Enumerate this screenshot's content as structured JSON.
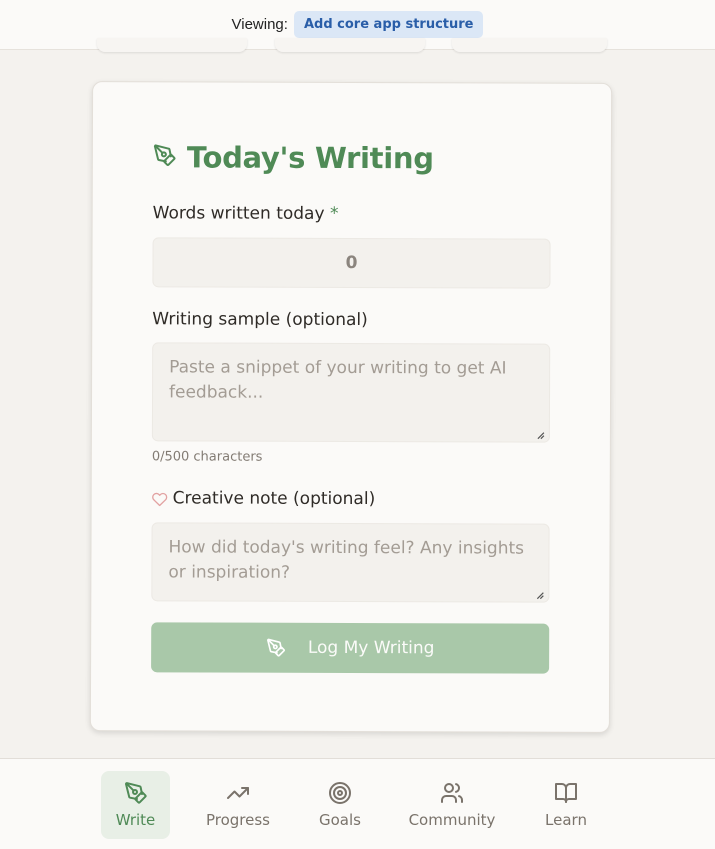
{
  "topbar": {
    "viewing_label": "Viewing:",
    "viewing_value": "Add core app structure"
  },
  "form": {
    "title": "Today's Writing",
    "words": {
      "label": "Words written today",
      "required_mark": "*",
      "value": "0"
    },
    "sample": {
      "label": "Writing sample (optional)",
      "placeholder": "Paste a snippet of your writing to get AI feedback...",
      "counter": "0/500 characters"
    },
    "note": {
      "label": "Creative note (optional)",
      "placeholder": "How did today's writing feel? Any insights or inspiration?"
    },
    "submit_label": "Log My Writing"
  },
  "nav": {
    "items": [
      {
        "label": "Write",
        "icon": "pen-nib-icon",
        "active": true
      },
      {
        "label": "Progress",
        "icon": "trending-up-icon",
        "active": false
      },
      {
        "label": "Goals",
        "icon": "target-icon",
        "active": false
      },
      {
        "label": "Community",
        "icon": "users-icon",
        "active": false
      },
      {
        "label": "Learn",
        "icon": "book-open-icon",
        "active": false
      }
    ]
  },
  "colors": {
    "accent": "#4f8a56",
    "button": "#a9c8a9",
    "chip_bg": "#dbe7f6",
    "chip_text": "#2a5ea8",
    "heart": "#e2a2a2"
  }
}
